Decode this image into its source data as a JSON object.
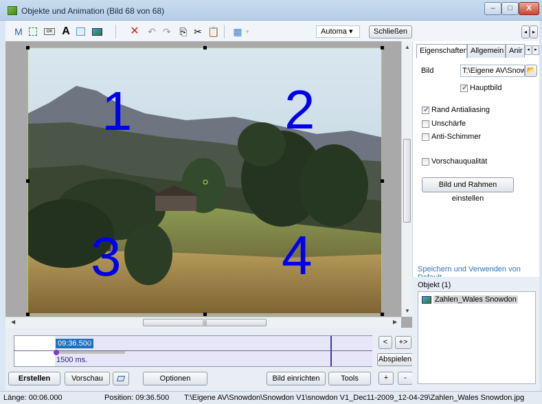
{
  "window": {
    "title": "Objekte und Animation  (Bild 68 von 68)",
    "minimize": "–",
    "maximize": "□",
    "close": "X"
  },
  "toolbar": {
    "m_label": "M",
    "text_label": "A",
    "ok_label": "OK",
    "mode_select": "Automa ▾",
    "close_button": "Schließen",
    "prev": "◂",
    "next": "▸"
  },
  "canvas": {
    "numbers": [
      "1",
      "2",
      "3",
      "4"
    ],
    "scroll_grip": "|||"
  },
  "timeline": {
    "time": "09:36.500",
    "plus": "+",
    "duration": "1500 ms.",
    "nav_prev": "<",
    "nav_next": "+>",
    "play_button": "Abspielen",
    "plus_button": "+",
    "minus_button": "-"
  },
  "bottom_buttons": {
    "create": "Erstellen",
    "preview": "Vorschau",
    "options": "Optionen",
    "setup_image": "Bild einrichten",
    "tools": "Tools"
  },
  "panel": {
    "tabs": [
      "Eigenschaften",
      "Allgemein",
      "Anir"
    ],
    "image_label": "Bild",
    "image_path": "T:\\Eigene AV\\Snowc",
    "main_image": "Hauptbild",
    "rand_antialiasing": "Rand Antialiasing",
    "blur": "Unschärfe",
    "anti_flicker": "Anti-Schimmer",
    "preview_quality": "Vorschauqualität",
    "frame_button": "Bild und Rahmen einstellen",
    "defaults_link": "Speichern und Verwenden von Default",
    "checked": {
      "main_image": true,
      "rand_antialiasing": true,
      "blur": false,
      "anti_flicker": false,
      "preview_quality": false
    }
  },
  "objects": {
    "header": "Objekt (1)",
    "items": [
      "Zahlen_Wales Snowdon"
    ]
  },
  "status": {
    "length": "Länge: 00:06.000",
    "position": "Position: 09:36.500",
    "path": "T:\\Eigene AV\\Snowdon\\Snowdon V1\\snowdon V1_Dec11-2009_12-04-29\\Zahlen_Wales Snowdon.jpg"
  }
}
